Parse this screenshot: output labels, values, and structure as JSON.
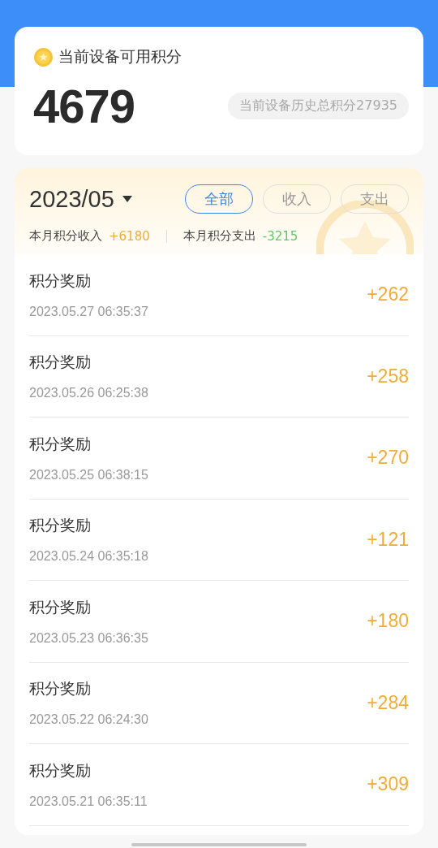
{
  "summary": {
    "label": "当前设备可用积分",
    "points": "4679",
    "history_total": "当前设备历史总积分27935"
  },
  "month": {
    "value": "2023/05",
    "filters": [
      {
        "label": "全部",
        "selected": true
      },
      {
        "label": "收入",
        "selected": false
      },
      {
        "label": "支出",
        "selected": false
      }
    ],
    "income_label": "本月积分收入",
    "income": "+6180",
    "expense_label": "本月积分支出",
    "expense": "-3215"
  },
  "records": [
    {
      "title": "积分奖励",
      "time": "2023.05.27 06:35:37",
      "amount": "+262"
    },
    {
      "title": "积分奖励",
      "time": "2023.05.26 06:25:38",
      "amount": "+258"
    },
    {
      "title": "积分奖励",
      "time": "2023.05.25 06:38:15",
      "amount": "+270"
    },
    {
      "title": "积分奖励",
      "time": "2023.05.24 06:35:18",
      "amount": "+121"
    },
    {
      "title": "积分奖励",
      "time": "2023.05.23 06:36:35",
      "amount": "+180"
    },
    {
      "title": "积分奖励",
      "time": "2023.05.22 06:24:30",
      "amount": "+284"
    },
    {
      "title": "积分奖励",
      "time": "2023.05.21 06:35:11",
      "amount": "+309"
    }
  ]
}
